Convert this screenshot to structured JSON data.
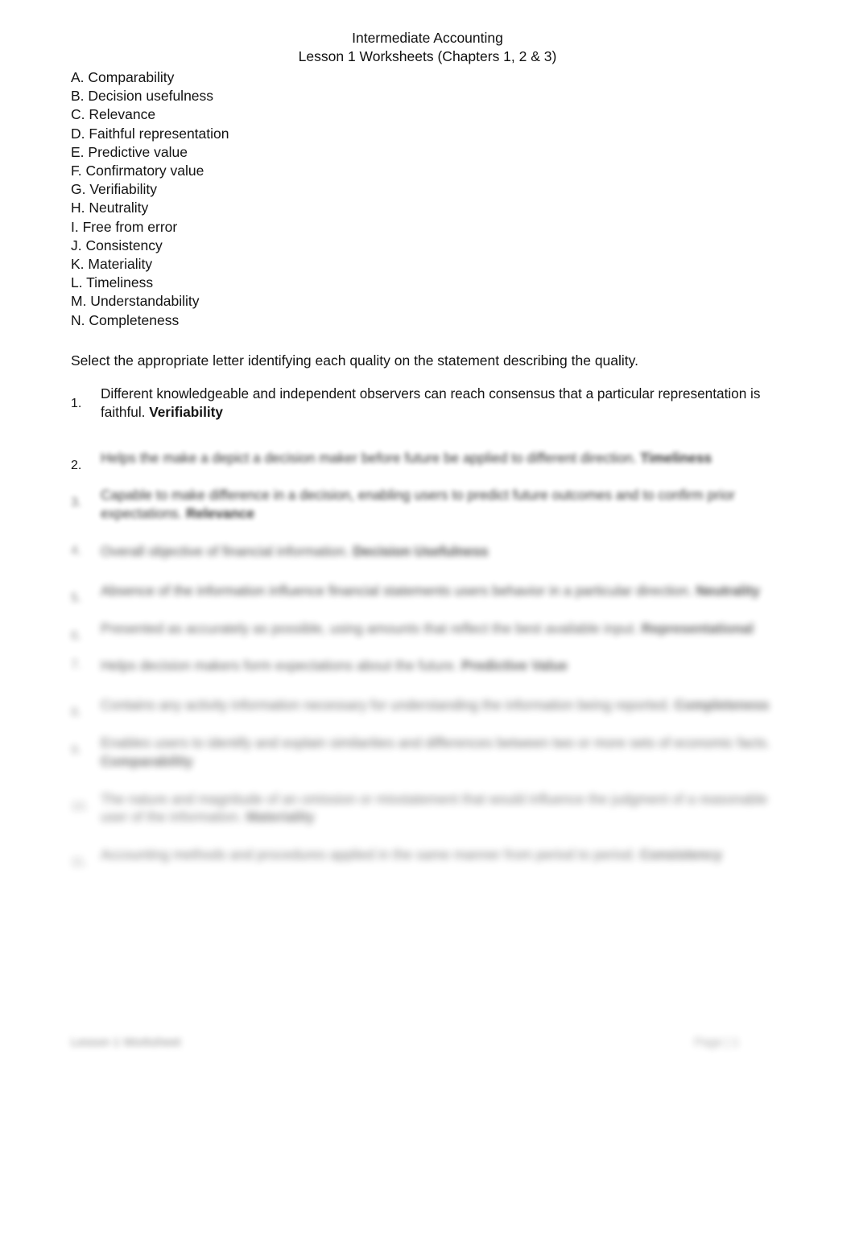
{
  "document": {
    "title_line_1": "Intermediate Accounting",
    "title_line_2": "Lesson 1 Worksheets (Chapters 1, 2 & 3)",
    "background_color": "#ffffff",
    "text_color": "#131313"
  },
  "quality_list": [
    {
      "letter": "A.",
      "label": "A. Comparability"
    },
    {
      "letter": "B.",
      "label": "B. Decision usefulness"
    },
    {
      "letter": "C.",
      "label": "C. Relevance"
    },
    {
      "letter": "D.",
      "label": "D. Faithful representation"
    },
    {
      "letter": "E.",
      "label": "E. Predictive value"
    },
    {
      "letter": "F.",
      "label": "F. Confirmatory value"
    },
    {
      "letter": "G.",
      "label": "G. Verifiability"
    },
    {
      "letter": "H.",
      "label": "H. Neutrality"
    },
    {
      "letter": "I.",
      "label": "I. Free from error"
    },
    {
      "letter": "J.",
      "label": "J. Consistency"
    },
    {
      "letter": "K.",
      "label": "K. Materiality"
    },
    {
      "letter": "L.",
      "label": "L. Timeliness"
    },
    {
      "letter": "M.",
      "label": "M. Understandability"
    },
    {
      "letter": "N.",
      "label": "N. Completeness"
    }
  ],
  "instruction": "Select the appropriate letter identifying each quality on the statement describing the quality.",
  "questions": [
    {
      "number": "1.",
      "statement": "Different knowledgeable and independent observers can reach consensus that a particular representation is faithful.",
      "answer": "Verifiability",
      "obscured": false
    },
    {
      "number": "2.",
      "statement": "Helps the make a depict a decision maker before future be applied to different direction.",
      "answer": "Timeliness",
      "obscured": true
    },
    {
      "number": "3.",
      "statement": "Capable to make difference in a decision, enabling users to predict future outcomes and to confirm prior expectations.",
      "answer": "Relevance",
      "obscured": true
    },
    {
      "number": "4.",
      "statement": "Overall objective of financial information.",
      "answer": "Decision Usefulness",
      "obscured": true
    },
    {
      "number": "5.",
      "statement": "Absence of the information influence financial statements users behavior in a particular direction.",
      "answer": "Neutrality",
      "obscured": true
    },
    {
      "number": "6.",
      "statement": "Presented as accurately as possible, using amounts that reflect the best available input.",
      "answer": "Representational",
      "obscured": true
    },
    {
      "number": "7.",
      "statement": "Helps decision makers form expectations about the future.",
      "answer": "Predictive Value",
      "obscured": true
    },
    {
      "number": "8.",
      "statement": "Contains any activity information necessary for understanding the information being reported.",
      "answer": "Completeness",
      "obscured": true
    },
    {
      "number": "9.",
      "statement": "Enables users to identify and explain similarities and differences between two or more sets of economic facts.",
      "answer": "Comparability",
      "obscured": true
    },
    {
      "number": "10.",
      "statement": "The nature and magnitude of an omission or misstatement that would influence the judgment of a reasonable user of the information.",
      "answer": "Materiality",
      "obscured": true
    },
    {
      "number": "11.",
      "statement": "Accounting methods and procedures applied in the same manner from period to period.",
      "answer": "Consistency",
      "obscured": true
    }
  ],
  "footer": {
    "left": "Lesson 1 Worksheet",
    "right": "Page | 1"
  }
}
